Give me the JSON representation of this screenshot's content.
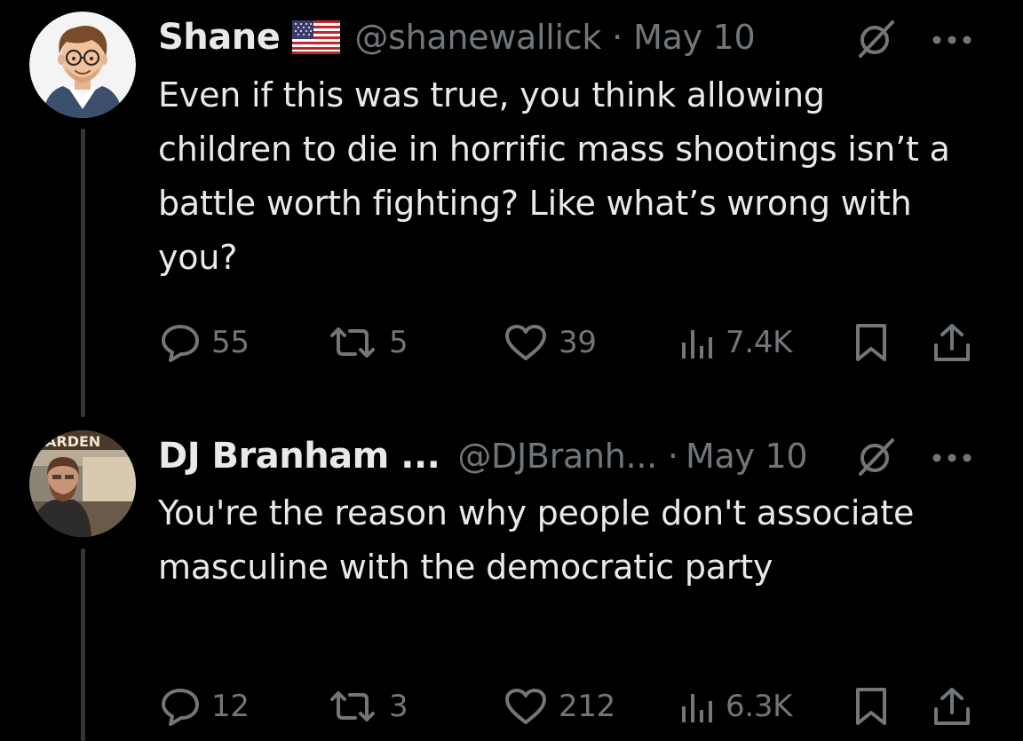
{
  "tweets": [
    {
      "author": {
        "name": "Shane",
        "handle": "@shanewallick",
        "has_flag": true
      },
      "date": "May 10",
      "separator": "·",
      "text": "Even if this was true, you think allowing children to die in horrific mass shootings isn’t a battle worth fighting? Like what’s wrong with you?",
      "stats": {
        "replies": "55",
        "reposts": "5",
        "likes": "39",
        "views": "7.4K"
      }
    },
    {
      "author": {
        "name": "DJ Branham ...",
        "handle": "@DJBranh...",
        "has_flag": false
      },
      "date": "May 10",
      "separator": "·",
      "text": "You're the reason why people don't associate masculine with the democratic party",
      "stats": {
        "replies": "12",
        "reposts": "3",
        "likes": "212",
        "views": "6.3K"
      }
    }
  ],
  "colors": {
    "background": "#000000",
    "primary_text": "#e7e9ea",
    "secondary_text": "#71767b",
    "thread_line": "#333639"
  },
  "icons": {
    "reply": "reply-icon",
    "repost": "repost-icon",
    "like": "heart-icon",
    "views": "views-icon",
    "bookmark": "bookmark-icon",
    "share": "share-icon",
    "more": "more-icon",
    "grok": "grok-icon"
  },
  "avatar_2_sign_text": "ARDEN"
}
